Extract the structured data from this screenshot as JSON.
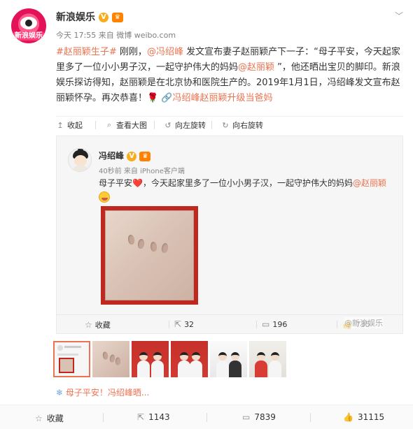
{
  "author": {
    "name": "新浪娱乐",
    "avatar_text": "新浪娱乐",
    "time": "今天 17:55",
    "source_prefix": "来自",
    "source": "微博 weibo.com"
  },
  "post": {
    "hashtag": "#赵丽颖生子#",
    "t1": " 刚刚，",
    "mention1": "@冯绍峰",
    "t2": " 发文宣布妻子赵丽颖产下一子：“母子平安，今天起家里多了一位小小男子汉，一起守护伟大的妈妈",
    "mention2": "@赵丽颖",
    "t3": " ”，他还晒出宝贝的脚印。新浪娱乐探访得知，赵丽颖是在北京协和医院生产的。2019年1月1日，冯绍峰发文宣布赵丽颖怀孕。再次恭喜！",
    "rose": "🌹",
    "link": "冯绍峰赵丽颖升级当爸妈"
  },
  "toolbar": {
    "collapse": "收起",
    "view_large": "查看大图",
    "rotate_left": "向左旋转",
    "rotate_right": "向右旋转"
  },
  "repost": {
    "name": "冯绍峰",
    "time": "40秒前",
    "source_prefix": "来自",
    "source": "iPhone客户端",
    "text1": "母子平安",
    "heart": "❤️",
    "text2": "，今天起家里多了一位小小男子汉，一起守护伟大的妈妈",
    "mention": "@赵丽颖",
    "actions": {
      "fav": "收藏",
      "repost_count": "32",
      "comment_count": "196",
      "like_count": "735"
    },
    "watermark": "@新浪娱乐"
  },
  "link_line": {
    "text": "母子平安！冯绍峰晒..."
  },
  "bottom": {
    "fav": "收藏",
    "repost": "1143",
    "comment": "7839",
    "like": "31115"
  },
  "colors": {
    "link": "#eb7350",
    "brand": "#e31259"
  }
}
